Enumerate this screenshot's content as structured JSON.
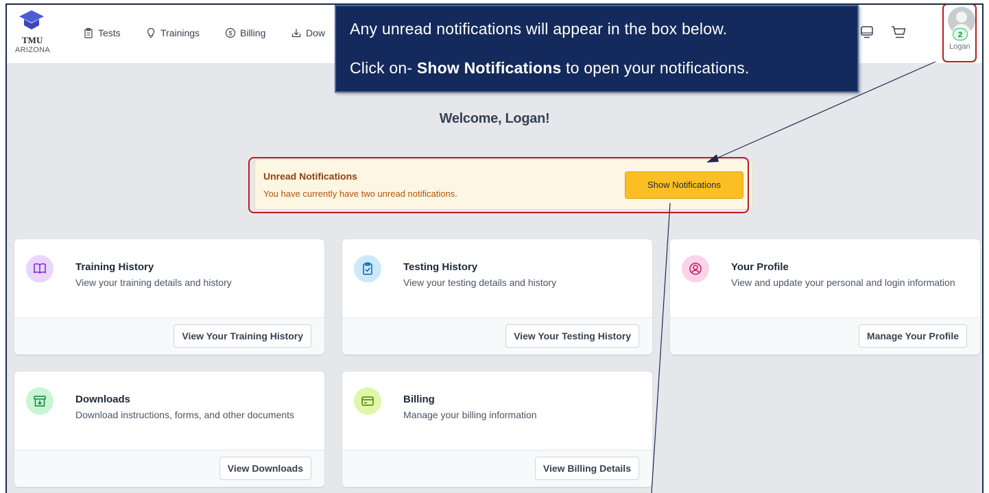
{
  "brand": {
    "name": "TMU",
    "sub": "ARIZONA"
  },
  "nav": [
    {
      "label": "Tests",
      "icon": "clipboard-icon"
    },
    {
      "label": "Trainings",
      "icon": "lightbulb-icon"
    },
    {
      "label": "Billing",
      "icon": "dollar-icon"
    },
    {
      "label": "Dow",
      "icon": "download-icon"
    }
  ],
  "user": {
    "name": "Logan",
    "notification_count": "2"
  },
  "callout": {
    "line1": "Any unread notifications will appear in the box below.",
    "line2_prefix": "Click on- ",
    "line2_bold": "Show Notifications",
    "line2_suffix": " to open your notifications."
  },
  "welcome": "Welcome, Logan!",
  "notifications": {
    "title": "Unread Notifications",
    "text": "You have currently have two unread notifications.",
    "button": "Show Notifications"
  },
  "cards": [
    {
      "title": "Training History",
      "desc": "View your training details and history",
      "button": "View Your Training History",
      "icon": "book-icon",
      "color": "#ead5fb",
      "icon_color": "#7e22ce"
    },
    {
      "title": "Testing History",
      "desc": "View your testing details and history",
      "button": "View Your Testing History",
      "icon": "clipboard-check-icon",
      "color": "#cce8fb",
      "icon_color": "#0369a1"
    },
    {
      "title": "Your Profile",
      "desc": "View and update your personal and login information",
      "button": "Manage Your Profile",
      "icon": "user-circle-icon",
      "color": "#fbd3ea",
      "icon_color": "#be185d"
    },
    {
      "title": "Downloads",
      "desc": "Download instructions, forms, and other documents",
      "button": "View Downloads",
      "icon": "archive-icon",
      "color": "#c8f5d4",
      "icon_color": "#15803d"
    },
    {
      "title": "Billing",
      "desc": "Manage your billing information",
      "button": "View Billing Details",
      "icon": "credit-card-icon",
      "color": "#dff7a8",
      "icon_color": "#4d7c0f"
    }
  ],
  "colors": {
    "callout_bg": "#152a5c",
    "highlight_red": "#b91c1c",
    "button_yellow": "#fbbf24"
  }
}
